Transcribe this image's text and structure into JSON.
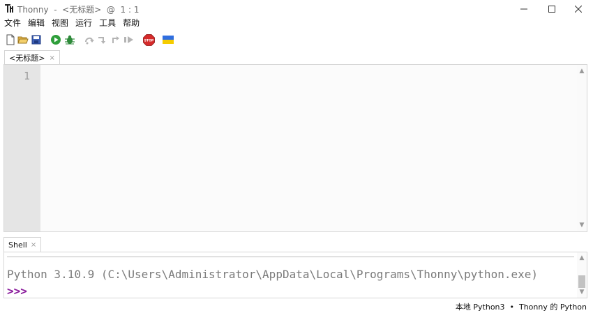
{
  "window": {
    "title": "Thonny  -  <无标题>  @  1 : 1"
  },
  "menu": {
    "items": [
      "文件",
      "编辑",
      "视图",
      "运行",
      "工具",
      "帮助"
    ]
  },
  "toolbar": {
    "icons": [
      "new-file-icon",
      "open-file-icon",
      "save-icon",
      "run-icon",
      "debug-icon",
      "step-over-icon",
      "step-into-icon",
      "step-out-icon",
      "resume-icon",
      "stop-icon",
      "ukraine-flag-icon"
    ],
    "stop_label": "STOP",
    "colors": {
      "run": "#2e9e3a",
      "stop": "#d62b2b",
      "flag_top": "#2f6ee0",
      "flag_bottom": "#f5cc00"
    }
  },
  "editor": {
    "tab_label": "<无标题>",
    "tab_close": "×",
    "line_numbers": [
      "1"
    ],
    "scroll_up": "▲",
    "scroll_down": "▼"
  },
  "shell": {
    "tab_label": "Shell",
    "tab_close": "×",
    "output": "Python 3.10.9 (C:\\Users\\Administrator\\AppData\\Local\\Programs\\Thonny\\python.exe)",
    "prompt": ">>>",
    "scroll_up": "▲",
    "scroll_down": "▼"
  },
  "status": {
    "text": "本地 Python3  •  Thonny 的 Python"
  }
}
